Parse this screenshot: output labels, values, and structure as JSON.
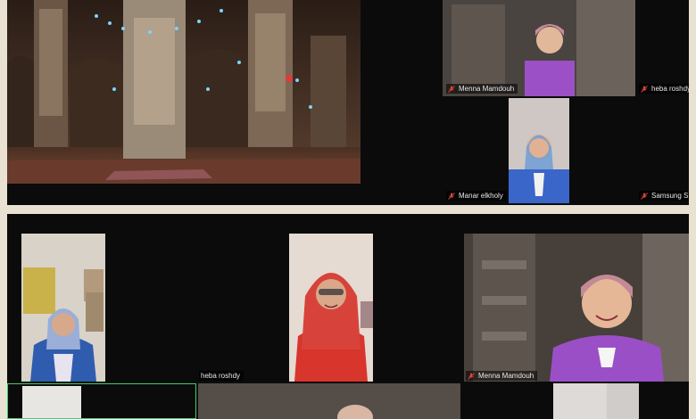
{
  "top_panel": {
    "shared_view": {
      "description_icon": "mosque-interior-image"
    },
    "tiles": [
      {
        "name": "Menna Mamdouh",
        "muted": true
      },
      {
        "name": "heba roshdy",
        "muted": true
      },
      {
        "name": "Manar elkholy",
        "muted": true
      },
      {
        "name": "Samsung S",
        "muted": true
      }
    ]
  },
  "bottom_panel": {
    "tiles": [
      {
        "name": "heba roshdy",
        "muted": false
      },
      {
        "name": "Menna Mamdouh",
        "muted": true
      }
    ],
    "active_speaker_color": "#3fcf6a"
  },
  "colors": {
    "frame_bg": "#e9e2d3",
    "panel_bg": "#0b0b0b",
    "muted_icon": "#e0463a"
  }
}
